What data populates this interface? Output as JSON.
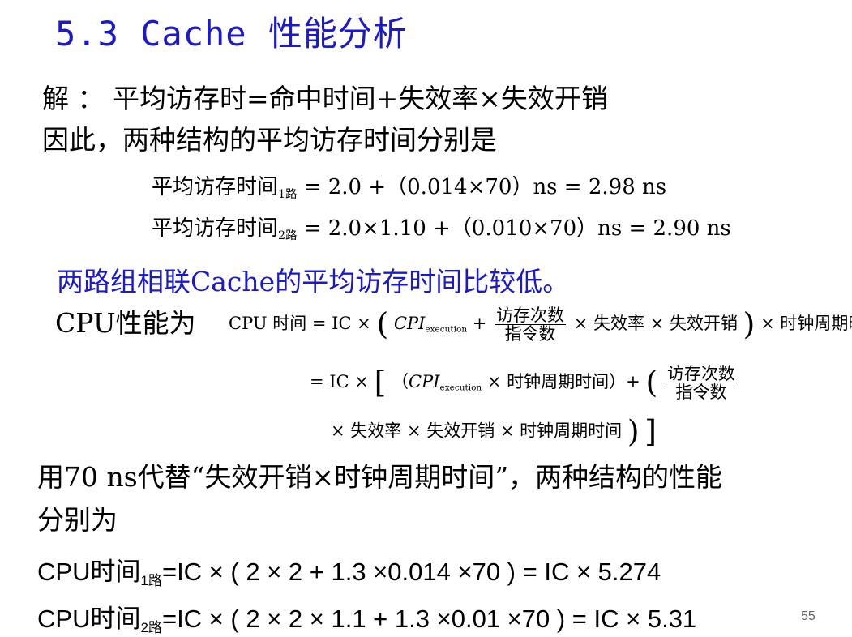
{
  "title": "5.3 Cache 性能分析",
  "solution": {
    "line1": "解 ：  平均访存时=命中时间+失效率×失效开销",
    "line2": "因此，两种结构的平均访存时间分别是",
    "eq1": {
      "lhs": "平均访存时间",
      "sub": "1路",
      "rhs": "= 2.0 +（0.014×70）ns = 2.98 ns"
    },
    "eq2": {
      "lhs": "平均访存时间",
      "sub": "2路",
      "rhs": "= 2.0×1.10 +（0.010×70）ns = 2.90 ns"
    },
    "conclusion": "两路组相联Cache的平均访存时间比较低。"
  },
  "cpu_perf": {
    "label": "CPU性能为",
    "f1_lhs": "CPU 时间 = IC ×",
    "cpi": "CPI",
    "cpi_sub": "execution",
    "plus": "+",
    "frac_num": "访存次数",
    "frac_den": "指令数",
    "f1_tail": "× 失效率 × 失效开销",
    "f1_end": "× 时钟周期时间",
    "f2_lhs": "= IC ×",
    "f2_mid": "× 时钟周期时间）+",
    "f3": "× 失效率 × 失效开销 × 时钟周期时间"
  },
  "substitution": {
    "line1": "用70 ns代替“失效开销×时钟周期时间”，两种结构的性能",
    "line2": "分别为"
  },
  "results": {
    "r1_lhs": "CPU时间",
    "r1_sub": "1路",
    "r1_rhs": "=IC × ( 2 × 2 + 1.3 ×0.014 ×70 ) = IC × 5.274",
    "r2_lhs": "CPU时间",
    "r2_sub": "2路",
    "r2_rhs": "=IC × ( 2 × 2 × 1.1 + 1.3 ×0.01 ×70 ) = IC × 5.31"
  },
  "page_number": "55"
}
